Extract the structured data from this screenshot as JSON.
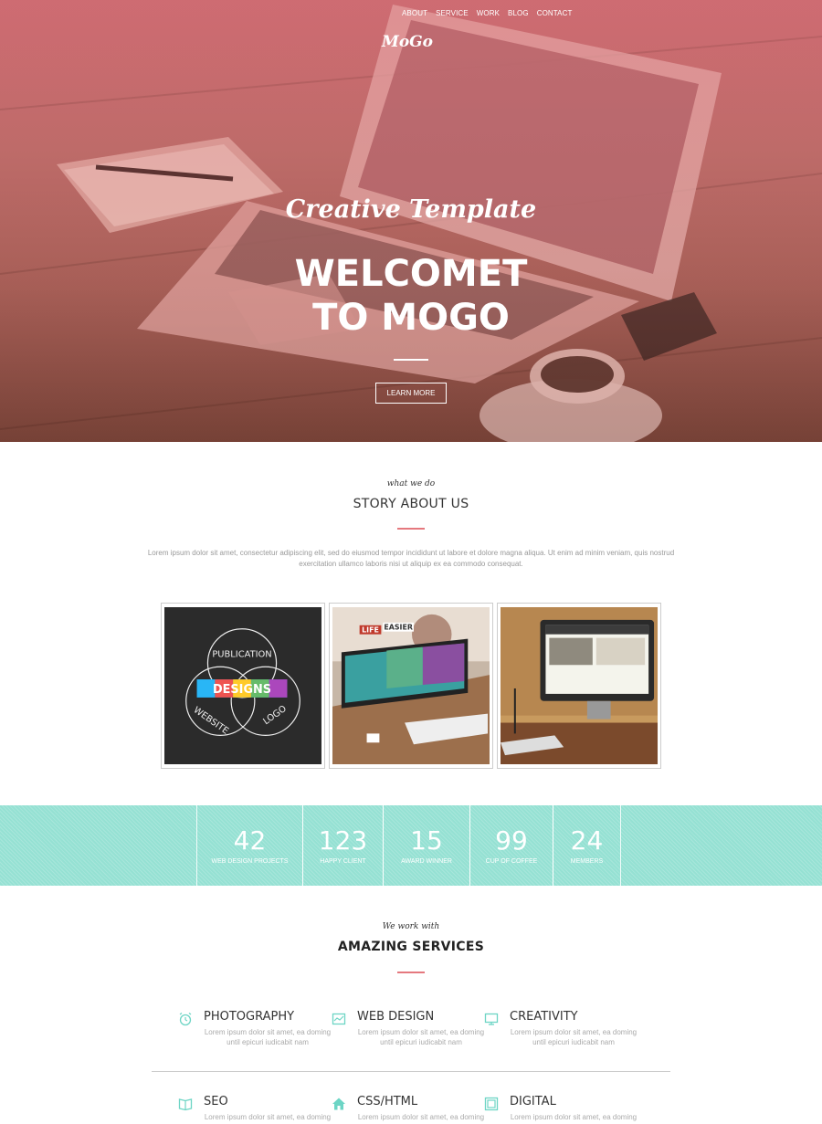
{
  "nav": {
    "items": [
      "ABOUT",
      "SERVICE",
      "WORK",
      "BLOG",
      "CONTACT"
    ],
    "logo": "MoGo"
  },
  "hero": {
    "subtitle": "Creative Template",
    "title_line1": "WELCOMET",
    "title_line2": "TO MOGO",
    "button": "LEARN MORE"
  },
  "story": {
    "kicker": "what we do",
    "title": "STORY ABOUT US",
    "text": "Lorem ipsum dolor sit amet, consectetur adipiscing elit, sed do eiusmod tempor incididunt ut labore et dolore magna aliqua. Ut enim ad minim veniam, quis nostrud exercitation ullamco laboris nisi ut aliquip ex ea commodo consequat.",
    "gallery": {
      "img1_words": [
        "PUBLICATION",
        "DESIGNS",
        "WEBSITE",
        "LOGO"
      ],
      "img2_words": [
        "LIFE",
        "EASIER"
      ]
    }
  },
  "stats": [
    {
      "num": "42",
      "label": "WEB DESIGN PROJECTS"
    },
    {
      "num": "123",
      "label": "HAPPY CLIENT"
    },
    {
      "num": "15",
      "label": "AWARD WINNER"
    },
    {
      "num": "99",
      "label": "CUP OF COFFEE"
    },
    {
      "num": "24",
      "label": "MEMBERS"
    }
  ],
  "services": {
    "kicker": "We work with",
    "title": "AMAZING SERVICES",
    "items": [
      {
        "title": "PHOTOGRAPHY",
        "icon": "alarm-clock-icon",
        "desc": "Lorem ipsum dolor sit amet, ea doming until epicuri iudicabit nam"
      },
      {
        "title": "WEB DESIGN",
        "icon": "chart-icon",
        "desc": "Lorem ipsum dolor sit amet, ea doming until epicuri iudicabit nam"
      },
      {
        "title": "CREATIVITY",
        "icon": "monitor-icon",
        "desc": "Lorem ipsum dolor sit amet, ea doming until epicuri iudicabit nam"
      },
      {
        "title": "SEO",
        "icon": "book-icon",
        "desc": "Lorem ipsum dolor sit amet, ea doming"
      },
      {
        "title": "CSS/HTML",
        "icon": "home-icon",
        "desc": "Lorem ipsum dolor sit amet, ea doming"
      },
      {
        "title": "DIGITAL",
        "icon": "frame-icon",
        "desc": "Lorem ipsum dolor sit amet, ea doming"
      }
    ]
  },
  "colors": {
    "hero_tint": "#c9696f",
    "accent_red": "#e5787e",
    "stats_teal": "#95e1d3",
    "icon_teal": "#6dd5c5"
  }
}
